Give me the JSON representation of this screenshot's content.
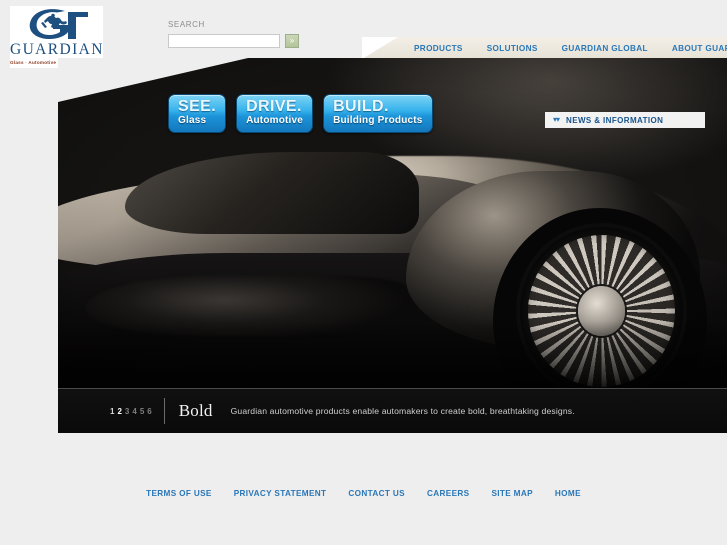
{
  "brand": {
    "name": "GUARDIAN",
    "tagline": "Glass · Automotive · Building Products",
    "logo_icon": "guardian-knight-g-logo",
    "blue": "#1d4f80",
    "tagline_color": "#8a3a1f"
  },
  "search": {
    "label": "SEARCH",
    "value": "",
    "placeholder": "",
    "button_icon": "double-chevron-right",
    "button_glyph": "»"
  },
  "nav": {
    "items": [
      {
        "label": "PRODUCTS"
      },
      {
        "label": "SOLUTIONS"
      },
      {
        "label": "GUARDIAN GLOBAL"
      },
      {
        "label": "ABOUT GUARDIAN"
      }
    ],
    "link_color": "#2a77b8"
  },
  "hero": {
    "pills": [
      {
        "top": "SEE.",
        "sub": "Glass"
      },
      {
        "top": "DRIVE.",
        "sub": "Automotive"
      },
      {
        "top": "BUILD.",
        "sub": "Building Products"
      }
    ],
    "news": {
      "label": "NEWS & INFORMATION",
      "icon": "double-chevron-down",
      "glyph": "»"
    },
    "caption": {
      "pages": [
        "1",
        "2",
        "3",
        "4",
        "5",
        "6"
      ],
      "current_page": "2",
      "title": "Bold",
      "text": "Guardian automotive products enable automakers to create bold, breathtaking designs."
    },
    "image_alt": "black concept sports car close-up with silver multi-spoke wheel"
  },
  "footer": {
    "links": [
      {
        "label": "TERMS OF USE"
      },
      {
        "label": "PRIVACY STATEMENT"
      },
      {
        "label": "CONTACT US"
      },
      {
        "label": "CAREERS"
      },
      {
        "label": "SITE MAP"
      },
      {
        "label": "HOME"
      }
    ]
  },
  "colors": {
    "page_background": "#eeeeee",
    "nav_background": "#ebe6da",
    "accent_blue": "#2a77b8",
    "pill_blue": "#36b2ec",
    "search_button_green": "#b3c499"
  }
}
